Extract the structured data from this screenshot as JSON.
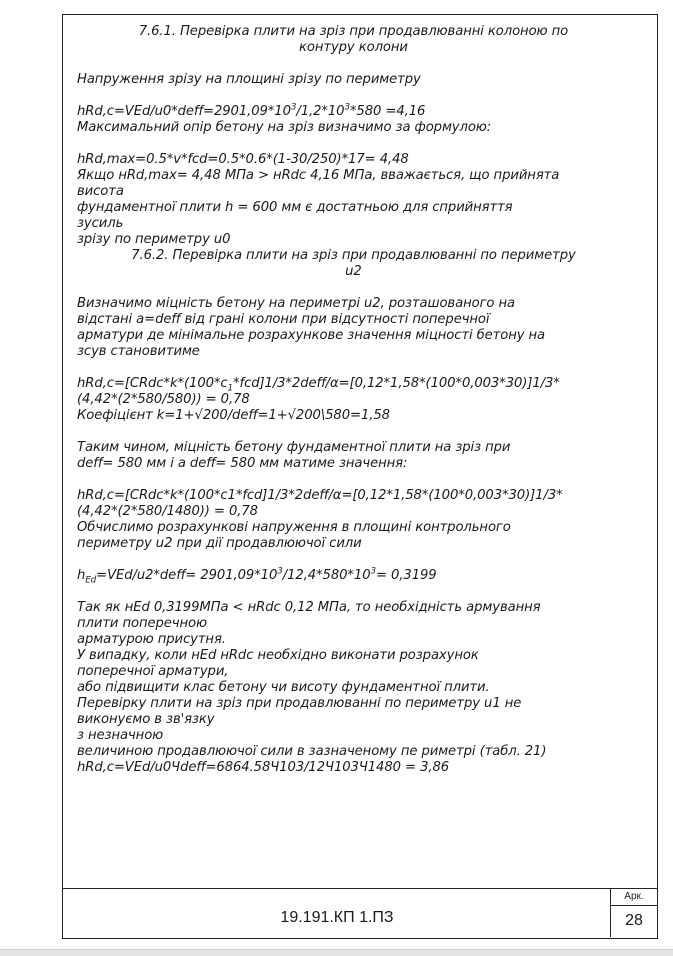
{
  "heading_1": {
    "line1": "7.6.1. Перевірка плити на зріз при продавлюванні колоною по",
    "line2": "контуру колони"
  },
  "para_1": "Напруження зрізу на площині зрізу по периметру",
  "formula_1": {
    "a": "hRd,c=VEd/u0*deff=2901,09*10",
    "sup_a": "3",
    "b": "/1,2*10",
    "sup_b": "3",
    "c": "*580 =4,16"
  },
  "para_2": "Максимальний опір бетону на зріз визначимо за формулою:",
  "formula_2": "hRd,max=0.5*v*fcd=0.5*0.6*(1-30/250)*17= 4,48",
  "para_3": {
    "l1": "Якщо нRd,max= 4,48 МПа > нRdc 4,16 МПа, вважається, що прийнята",
    "l2": "висота",
    "l3": "фундаментної плити h = 600 мм є достатньою для сприйняття",
    "l4": "зусиль",
    "l5": "зрізу по периметру u0"
  },
  "heading_2": {
    "line1": "7.6.2. Перевірка плити на зріз при продавлюванні по периметру",
    "line2": "u2"
  },
  "para_4": {
    "l1": "Визначимо міцність бетону на периметрі u2, розташованого на",
    "l2": "відстані a=deff від грані колони при відсутності поперечної",
    "l3": "арматури де мінімальне розрахункове значення міцності бетону на",
    "l4": "зсув становитиме"
  },
  "formula_3": {
    "a": "hRd,c=[CRdc*k*(100*c",
    "sub_a": "1",
    "b": "*fcd]1/3*2deff/α=[0,12*1,58*(100*0,003*30)]1/3*",
    "l2": "(4,42*(2*580/580)) = 0,78",
    "l3": "Коефіцієнт k=1+√200/deff=1+√200\\580=1,58"
  },
  "para_5": {
    "l1": "Таким чином, міцність бетону фундаментної плити на зріз при",
    "l2": "deff= 580 мм і a deff= 580 мм матиме значення:"
  },
  "formula_4": {
    "l1": "hRd,c=[CRdc*k*(100*c1*fcd]1/3*2deff/α=[0,12*1,58*(100*0,003*30)]1/3*",
    "l2": "(4,42*(2*580/1480)) = 0,78"
  },
  "para_6": {
    "l1": "Обчислимо розрахункові напруження в площині контрольного",
    "l2": "периметру u2 при дії продавлюючої сили"
  },
  "formula_5": {
    "a": "h",
    "sub_a": "Ed",
    "b": "=VEd/u2*deff= 2901,09*10",
    "sup_b": "3",
    "c": "/12,4*580*10",
    "sup_c": "3",
    "d": "= 0,3199"
  },
  "para_7": {
    "l1": "Так як нEd 0,3199МПа < нRdc 0,12 МПа, то необхідність армування",
    "l2": "плити поперечною",
    "l3": "арматурою присутня.",
    "l4": "У випадку, коли нEd нRdc необхідно виконати розрахунок",
    "l5": "поперечної арматури,",
    "l6": "або підвищити клас бетону чи висоту фундаментної плити.",
    "l7": "Перевірку плити на зріз при продавлюванні по периметру u1 не",
    "l8": "виконуємо в зв'язку",
    "l9": "з незначною",
    "l10": "величиною продавлюючої сили в зазначеному пе риметрі (табл. 21)",
    "l11": "hRd,c=VEd/u0Чdeff=6864.58Ч103/12Ч103Ч1480 = 3,86"
  },
  "title_block": {
    "doc_code": "19.191.КП 1.ПЗ",
    "sheet_label": "Арк.",
    "sheet_number": "28"
  }
}
